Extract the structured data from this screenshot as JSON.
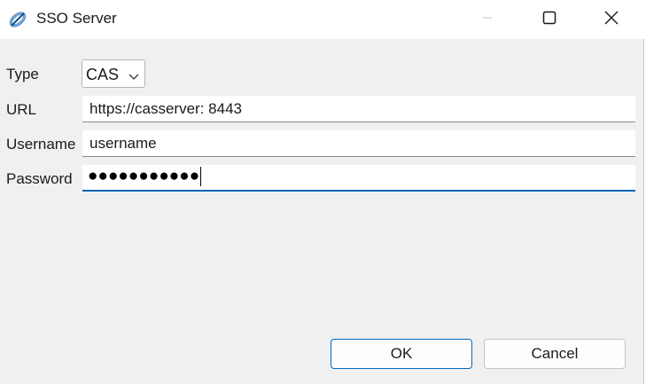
{
  "window": {
    "title": "SSO Server",
    "minimize_icon": "minimize-icon",
    "maximize_icon": "maximize-icon",
    "close_icon": "close-icon"
  },
  "form": {
    "type": {
      "label": "Type",
      "value": "CAS",
      "icon": "chevron-down-icon"
    },
    "url": {
      "label": "URL",
      "value": "https://casserver: 8443"
    },
    "username": {
      "label": "Username",
      "value": "username"
    },
    "password": {
      "label": "Password",
      "masked_value": "●●●●●●●●●●●"
    }
  },
  "buttons": {
    "ok": "OK",
    "cancel": "Cancel"
  },
  "colors": {
    "accent": "#0063b1",
    "background": "#f0f0f0"
  }
}
